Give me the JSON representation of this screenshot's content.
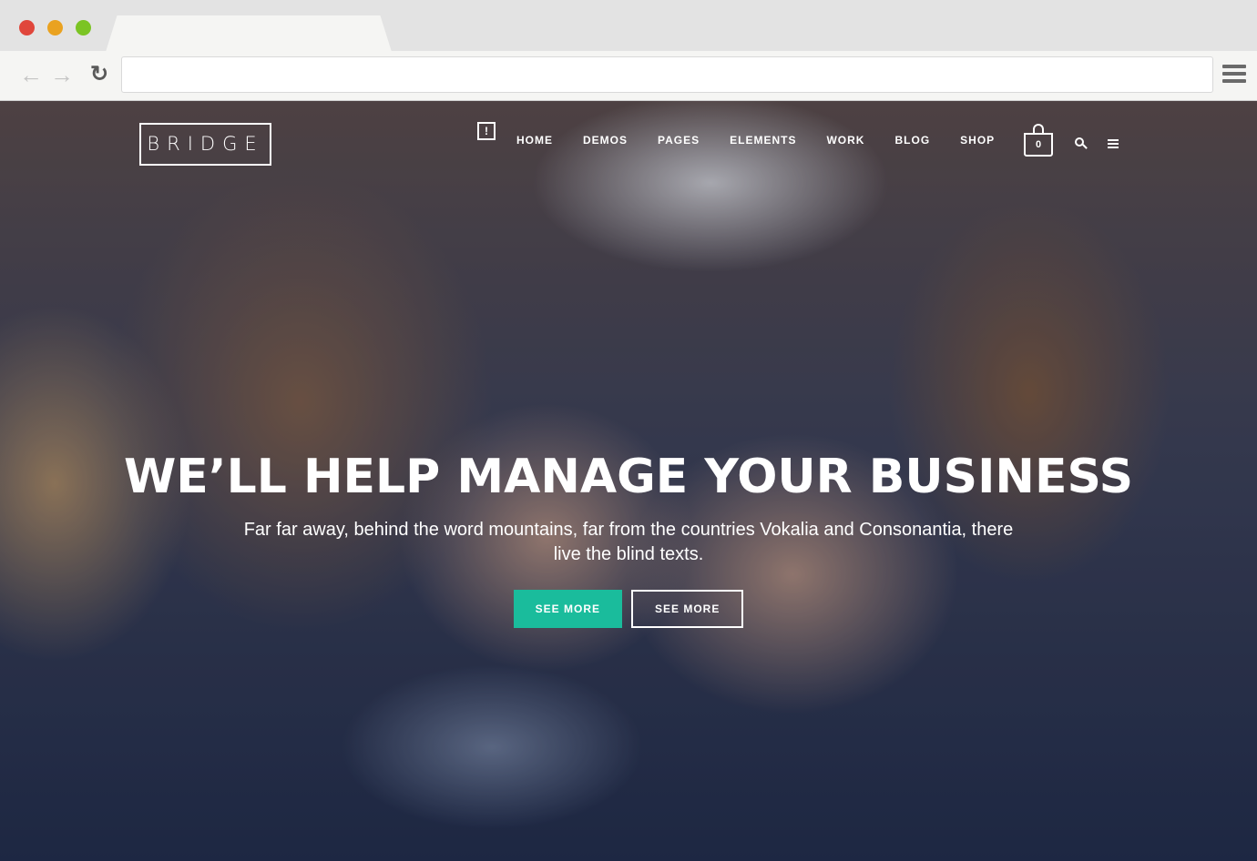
{
  "browser": {
    "url": "",
    "colors": {
      "close": "#e0463b",
      "minimize": "#eaa220",
      "maximize": "#7bc424"
    }
  },
  "site": {
    "logo": "BRIDGE",
    "nav": [
      "HOME",
      "DEMOS",
      "PAGES",
      "ELEMENTS",
      "WORK",
      "BLOG",
      "SHOP"
    ],
    "cart_count": "0",
    "notice_icon": "!"
  },
  "hero": {
    "title": "WE’LL HELP MANAGE YOUR BUSINESS",
    "subtitle": "Far far away, behind the word mountains, far from the countries Vokalia and Consonantia, there live the blind texts.",
    "primary_button": "SEE MORE",
    "secondary_button": "SEE MORE",
    "accent": "#1abc9c"
  }
}
